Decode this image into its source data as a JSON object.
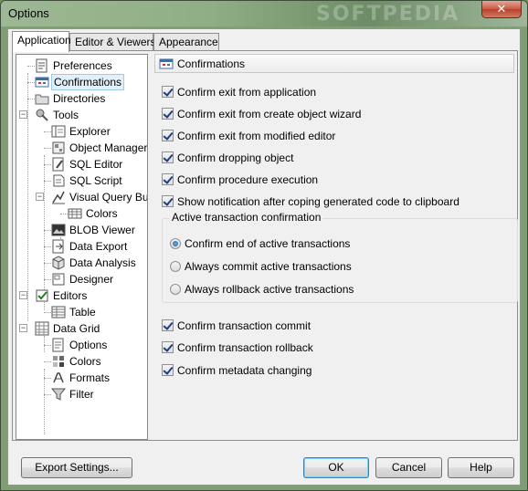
{
  "window": {
    "title": "Options",
    "watermark": "SOFTPEDIA",
    "close_glyph": "✕"
  },
  "tabs": [
    {
      "label": "Application",
      "active": true
    },
    {
      "label": "Editor & Viewers",
      "active": false
    },
    {
      "label": "Appearance",
      "active": false
    }
  ],
  "tree": {
    "watermark": "SOFTPEDIA",
    "items": [
      {
        "label": "Preferences",
        "icon": "preferences-icon",
        "level": 1
      },
      {
        "label": "Confirmations",
        "icon": "confirmations-icon",
        "level": 1,
        "selected": true
      },
      {
        "label": "Directories",
        "icon": "folder-icon",
        "level": 1
      },
      {
        "label": "Tools",
        "icon": "tools-icon",
        "level": 1,
        "expander": "−"
      },
      {
        "label": "Explorer",
        "icon": "explorer-icon",
        "level": 2
      },
      {
        "label": "Object Manager",
        "icon": "object-manager-icon",
        "level": 2
      },
      {
        "label": "SQL Editor",
        "icon": "sql-editor-icon",
        "level": 2
      },
      {
        "label": "SQL Script",
        "icon": "sql-script-icon",
        "level": 2
      },
      {
        "label": "Visual Query Builder",
        "icon": "visual-query-icon",
        "level": 2,
        "expander": "−"
      },
      {
        "label": "Colors",
        "icon": "grid-icon",
        "level": 3
      },
      {
        "label": "BLOB Viewer",
        "icon": "blob-viewer-icon",
        "level": 2
      },
      {
        "label": "Data Export",
        "icon": "data-export-icon",
        "level": 2
      },
      {
        "label": "Data Analysis",
        "icon": "data-analysis-icon",
        "level": 2
      },
      {
        "label": "Designer",
        "icon": "designer-icon",
        "level": 2
      },
      {
        "label": "Editors",
        "icon": "editors-icon",
        "level": 1,
        "expander": "−"
      },
      {
        "label": "Table",
        "icon": "table-icon",
        "level": 2
      },
      {
        "label": "Data Grid",
        "icon": "data-grid-icon",
        "level": 1,
        "expander": "−"
      },
      {
        "label": "Options",
        "icon": "options-icon",
        "level": 2
      },
      {
        "label": "Colors",
        "icon": "colors-icon",
        "level": 2
      },
      {
        "label": "Formats",
        "icon": "formats-icon",
        "level": 2
      },
      {
        "label": "Filter",
        "icon": "filter-icon",
        "level": 2
      }
    ]
  },
  "section": {
    "title": "Confirmations"
  },
  "checkboxes_top": [
    {
      "label": "Confirm exit from application",
      "checked": true
    },
    {
      "label": "Confirm exit from create object wizard",
      "checked": true
    },
    {
      "label": "Confirm exit from modified editor",
      "checked": true
    },
    {
      "label": "Confirm dropping object",
      "checked": true
    },
    {
      "label": "Confirm procedure execution",
      "checked": true
    },
    {
      "label": "Show notification after coping generated code to clipboard",
      "checked": true
    }
  ],
  "transaction_group": {
    "title": "Active transaction confirmation",
    "options": [
      {
        "label": "Confirm end of active transactions",
        "selected": true
      },
      {
        "label": "Always commit active transactions",
        "selected": false
      },
      {
        "label": "Always rollback active transactions",
        "selected": false
      }
    ]
  },
  "checkboxes_bottom": [
    {
      "label": "Confirm transaction commit",
      "checked": true
    },
    {
      "label": "Confirm transaction rollback",
      "checked": true
    },
    {
      "label": "Confirm metadata changing",
      "checked": true
    }
  ],
  "buttons": {
    "export": "Export Settings...",
    "ok": "OK",
    "cancel": "Cancel",
    "help": "Help"
  },
  "colors": {
    "selection": "#e2f0fb",
    "check": "#1c3e8a",
    "radio": "#1b4f9c"
  }
}
